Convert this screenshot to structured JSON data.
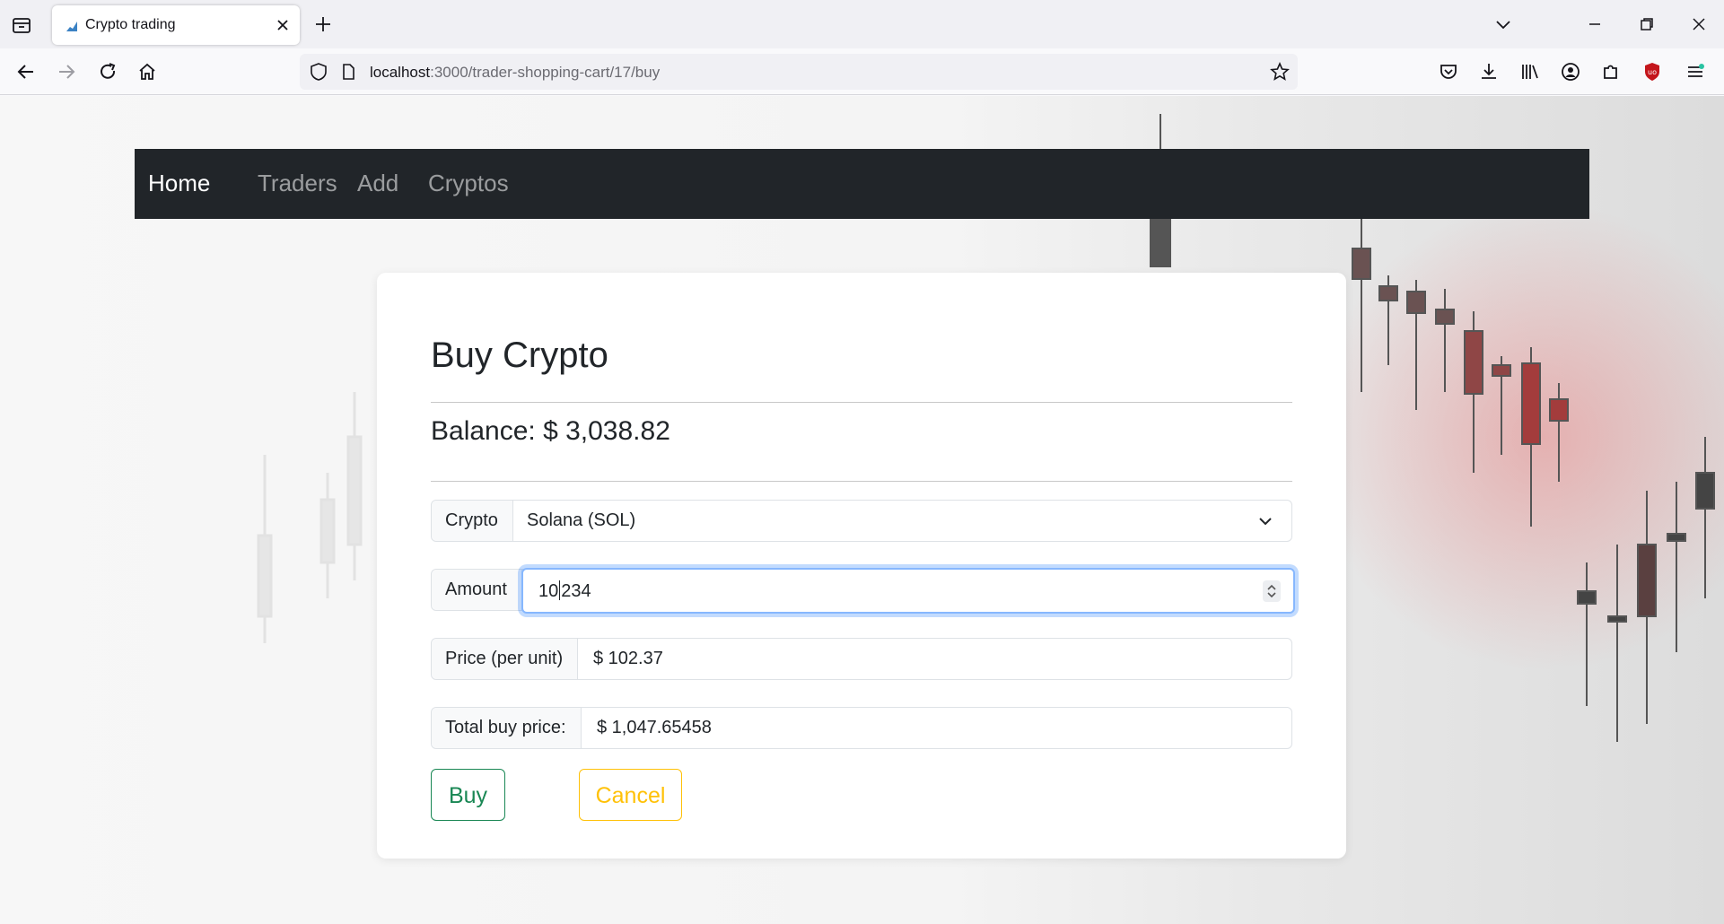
{
  "browser": {
    "tab_title": "Crypto trading",
    "url_host": "localhost",
    "url_rest": ":3000/trader-shopping-cart/17/buy"
  },
  "site_nav": {
    "brand": "Home",
    "links": [
      "Traders",
      "Add",
      "Cryptos"
    ]
  },
  "form": {
    "title": "Buy Crypto",
    "balance": "Balance: $ 3,038.82",
    "crypto_label": "Crypto",
    "crypto_selected": "Solana (SOL)",
    "amount_label": "Amount",
    "amount_before_caret": "10",
    "amount_after_caret": "234",
    "price_label": "Price (per unit)",
    "price_value": "$ 102.37",
    "total_label": "Total buy price:",
    "total_value": "$ 1,047.65458",
    "buy_label": "Buy",
    "cancel_label": "Cancel"
  },
  "colors": {
    "navbar_bg": "#212529",
    "buy_accent": "#198754",
    "cancel_accent": "#ffc107",
    "focus_ring": "#86b7fe"
  }
}
